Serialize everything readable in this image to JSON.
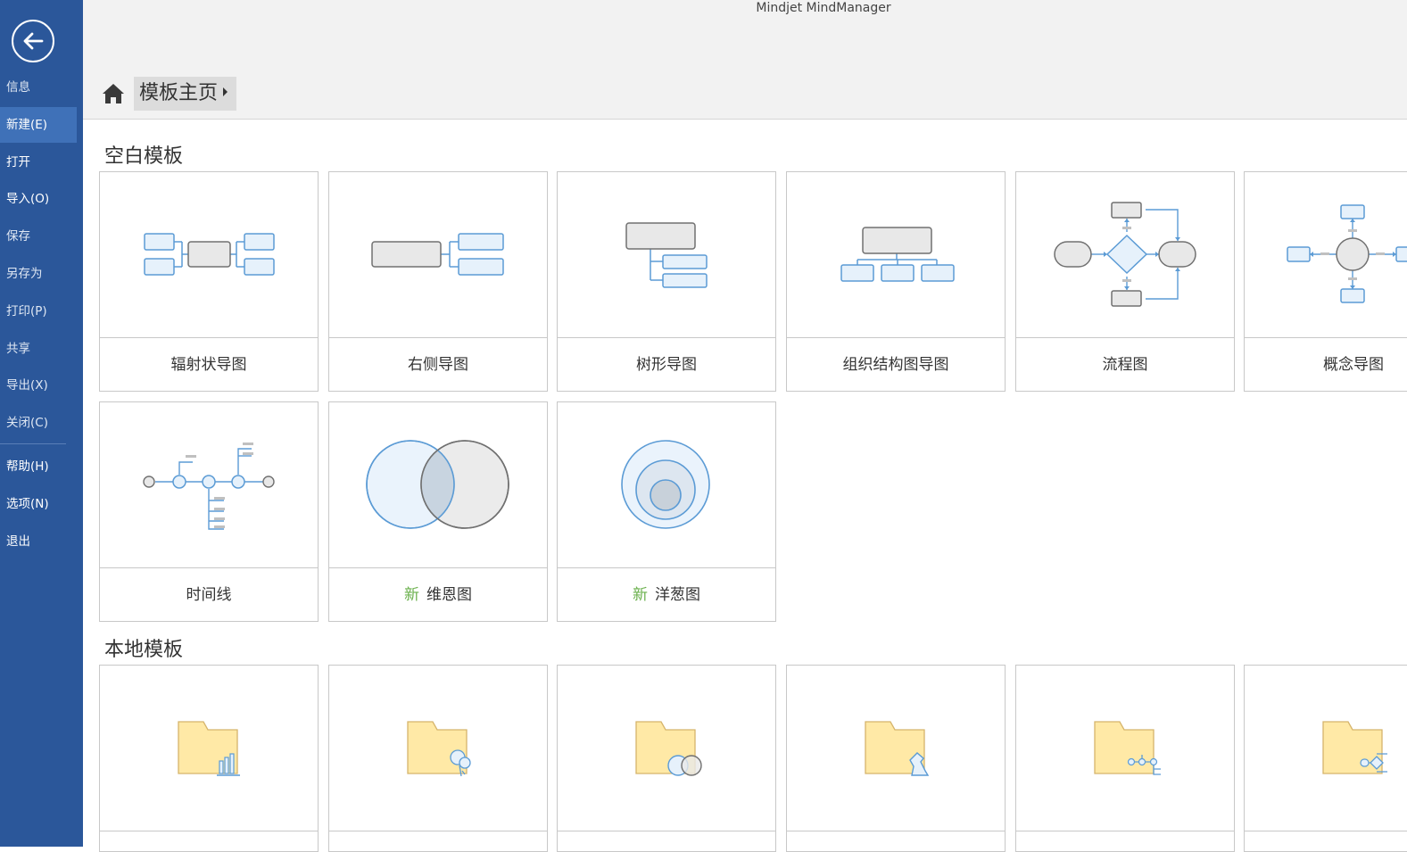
{
  "app_title": "Mindjet MindManager",
  "sidebar": {
    "items": [
      {
        "label": "信息"
      },
      {
        "label": "新建(E)"
      },
      {
        "label": "打开"
      },
      {
        "label": "导入(O)"
      },
      {
        "label": "保存"
      },
      {
        "label": "另存为"
      },
      {
        "label": "打印(P)"
      },
      {
        "label": "共享"
      },
      {
        "label": "导出(X)"
      },
      {
        "label": "关闭(C)"
      },
      {
        "label": "帮助(H)"
      },
      {
        "label": "选项(N)"
      },
      {
        "label": "退出"
      }
    ]
  },
  "breadcrumb": {
    "label": "模板主页"
  },
  "blank_section": {
    "title": "空白模板",
    "tiles": [
      {
        "label": "辐射状导图",
        "icon": "radial-map-icon"
      },
      {
        "label": "右侧导图",
        "icon": "right-map-icon"
      },
      {
        "label": "树形导图",
        "icon": "tree-map-icon"
      },
      {
        "label": "组织结构图导图",
        "icon": "org-chart-icon"
      },
      {
        "label": "流程图",
        "icon": "flowchart-icon"
      },
      {
        "label": "概念导图",
        "icon": "concept-map-icon"
      },
      {
        "label": "时间线",
        "icon": "timeline-icon"
      },
      {
        "label": "维恩图",
        "badge": "新",
        "icon": "venn-diagram-icon"
      },
      {
        "label": "洋葱图",
        "badge": "新",
        "icon": "onion-diagram-icon"
      }
    ]
  },
  "local_section": {
    "title": "本地模板",
    "tiles": [
      {
        "icon": "folder-chart-icon"
      },
      {
        "icon": "folder-ideas-icon"
      },
      {
        "icon": "folder-venn-icon"
      },
      {
        "icon": "folder-strategy-icon"
      },
      {
        "icon": "folder-process-icon"
      },
      {
        "icon": "folder-flow-icon"
      }
    ]
  },
  "colors": {
    "sidebar_bg": "#2b579a",
    "sidebar_active": "#3f71b8",
    "topic_gray": "#e8e8e8",
    "topic_blue_fill": "#e6f1fb",
    "topic_blue_stroke": "#5b9bd5",
    "new_badge": "#6ab04c",
    "folder": "#ffe9a6"
  }
}
